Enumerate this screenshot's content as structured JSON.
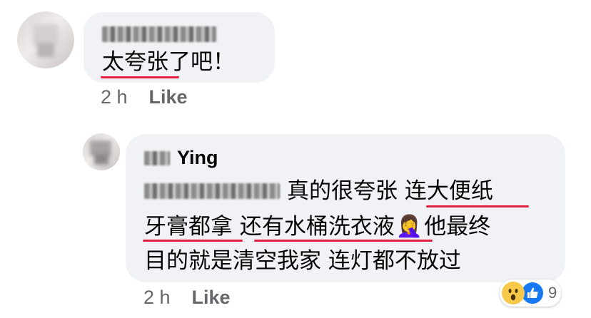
{
  "comment1": {
    "author": "",
    "text": "太夸张了吧！",
    "time": "2 h",
    "like_label": "Like"
  },
  "reply1": {
    "author": "Ying",
    "mention": "",
    "lines": [
      "真的很夸张 连大便纸",
      "牙膏都拿 还有水桶洗衣液",
      "他最终",
      "目的就是清空我家 连灯都不放过"
    ],
    "emoji": "🤦‍♀️",
    "time": "2 h",
    "like_label": "Like",
    "reaction_count": "9",
    "reaction_icons": [
      "wow-icon",
      "thumbs-up-icon"
    ]
  },
  "colors": {
    "bubble": "#f0f2f5",
    "meta_text": "#65676b",
    "underline": "#e41e3f",
    "like_blue": "#1877f2"
  }
}
